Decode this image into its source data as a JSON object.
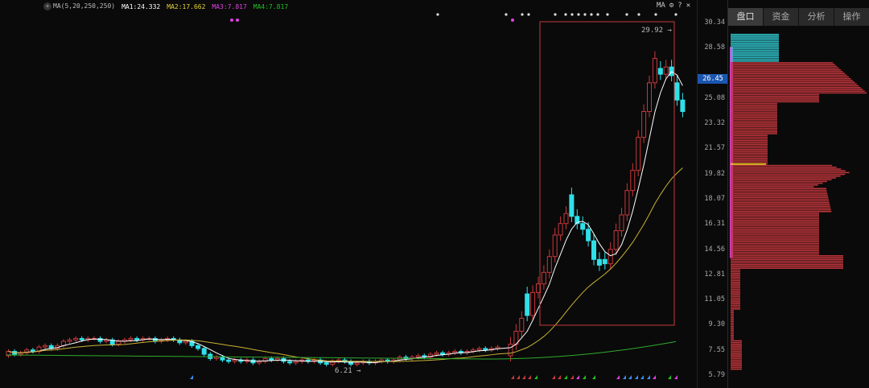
{
  "legend": {
    "ma_label": "MA",
    "ma_params": "(5,20,250,250)",
    "ma1": "MA1:24.332",
    "ma2": "MA2:17.662",
    "ma3": "MA3:7.817",
    "ma4": "MA4:7.817",
    "ma1_color": "#ffffff",
    "ma2_color": "#e8d23a",
    "ma3_color": "#e040e0",
    "ma4_color": "#20c020"
  },
  "window_controls": {
    "ma_label": "MA",
    "settings_icon": "gear-icon",
    "help": "?",
    "close": "✕"
  },
  "price_axis": {
    "ticks": [
      "30.34",
      "28.58",
      "25.08",
      "23.32",
      "21.57",
      "19.82",
      "18.07",
      "16.31",
      "14.56",
      "12.81",
      "11.05",
      "9.30",
      "7.55",
      "5.79"
    ],
    "current_price": "26.45"
  },
  "annotations": {
    "high": "29.92",
    "low": "6.21"
  },
  "side_panel": {
    "tabs": [
      "盘口",
      "资金",
      "分析",
      "操作"
    ]
  },
  "colors": {
    "up": "#c8373b",
    "down": "#2fe0e8",
    "ma20": "#c9b233",
    "ma250": "#2eaa2e",
    "highlight_box": "#c23a3a",
    "volume_profile": "#b8343a",
    "profile_cyan": "#2fc0c8"
  }
}
